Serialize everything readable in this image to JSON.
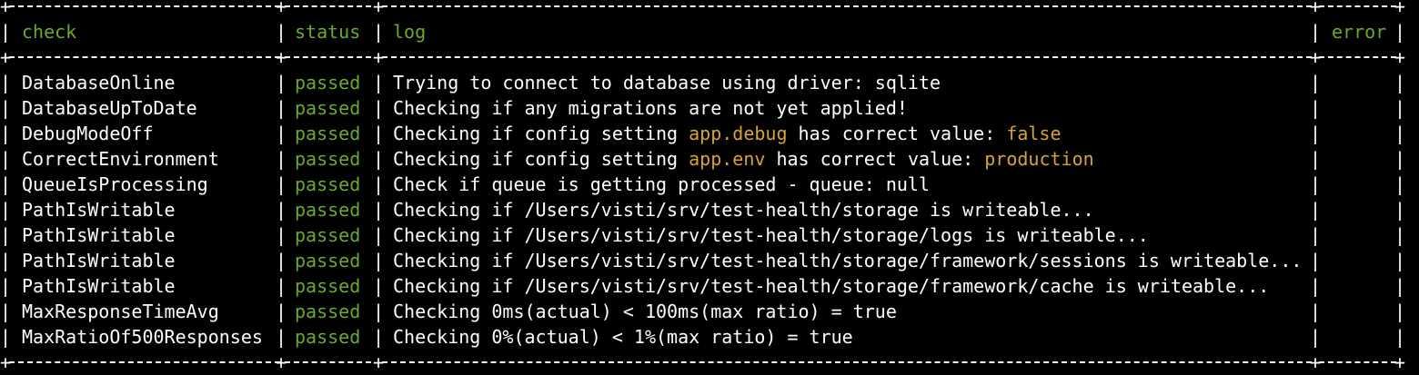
{
  "table": {
    "headers": {
      "check": "check",
      "status": "status",
      "log": "log",
      "error": "error"
    },
    "rows": [
      {
        "check": "DatabaseOnline",
        "status": "passed",
        "log": [
          "Trying to connect to database using driver: sqlite"
        ],
        "error": ""
      },
      {
        "check": "DatabaseUpToDate",
        "status": "passed",
        "log": [
          "Checking if any migrations are not yet applied!"
        ],
        "error": ""
      },
      {
        "check": "DebugModeOff",
        "status": "passed",
        "log": [
          "Checking if config setting ",
          "app.debug",
          " has correct value: ",
          "false"
        ],
        "error": ""
      },
      {
        "check": "CorrectEnvironment",
        "status": "passed",
        "log": [
          "Checking if config setting ",
          "app.env",
          " has correct value: ",
          "production"
        ],
        "error": ""
      },
      {
        "check": "QueueIsProcessing",
        "status": "passed",
        "log": [
          "Check if queue is getting processed - queue: null"
        ],
        "error": ""
      },
      {
        "check": "PathIsWritable",
        "status": "passed",
        "log": [
          "Checking if /Users/visti/srv/test-health/storage is writeable..."
        ],
        "error": ""
      },
      {
        "check": "PathIsWritable",
        "status": "passed",
        "log": [
          "Checking if /Users/visti/srv/test-health/storage/logs is writeable..."
        ],
        "error": ""
      },
      {
        "check": "PathIsWritable",
        "status": "passed",
        "log": [
          "Checking if /Users/visti/srv/test-health/storage/framework/sessions is writeable..."
        ],
        "error": ""
      },
      {
        "check": "PathIsWritable",
        "status": "passed",
        "log": [
          "Checking if /Users/visti/srv/test-health/storage/framework/cache is writeable..."
        ],
        "error": ""
      },
      {
        "check": "MaxResponseTimeAvg",
        "status": "passed",
        "log": [
          "Checking 0ms(actual) < 100ms(max ratio) = true"
        ],
        "error": ""
      },
      {
        "check": "MaxRatioOf500Responses",
        "status": "passed",
        "log": [
          "Checking 0%(actual) < 1%(max ratio) = true"
        ],
        "error": ""
      }
    ]
  },
  "colors": {
    "background": "#000000",
    "text": "#ffffff",
    "accent_green": "#6aaa2a",
    "highlight_yellow": "#d4a531"
  }
}
